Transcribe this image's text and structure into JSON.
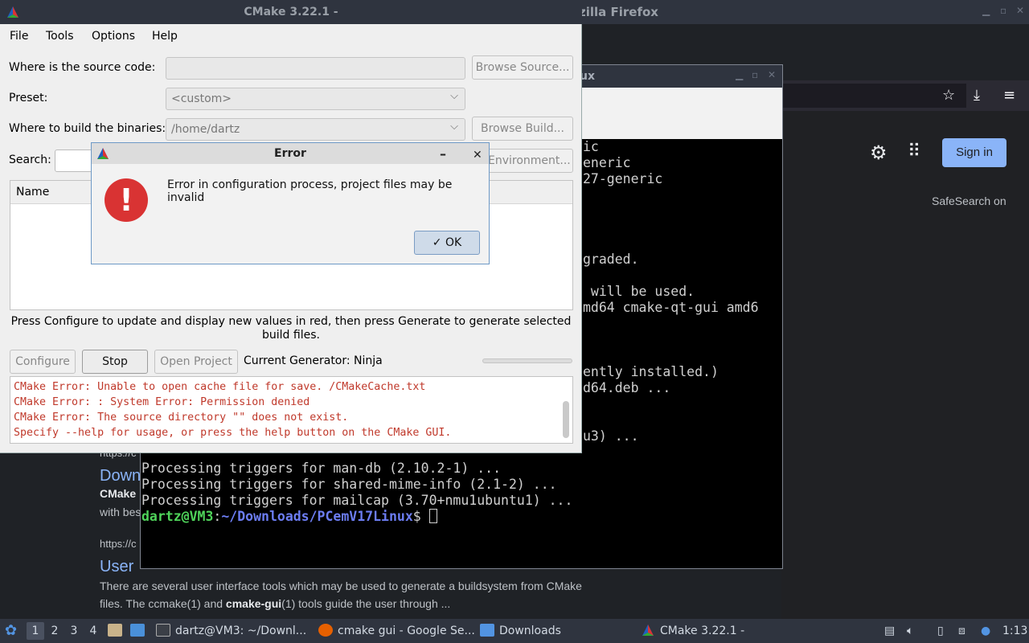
{
  "firefox": {
    "title": "zilla Firefox",
    "signin": "Sign in",
    "safesearch": "SafeSearch on",
    "results": [
      {
        "url": "https://c",
        "title": "Downl",
        "snippet_bold": "CMake",
        "snippet": "with bes"
      },
      {
        "url": "https://c",
        "title": "User",
        "snippet": "There are several user interface tools which may be used to generate a buildsystem from CMake",
        "snippet2_pre": "files. The ccmake(1) and ",
        "snippet2_bold": "cmake-gui",
        "snippet2_post": "(1) tools guide the user through ..."
      }
    ]
  },
  "terminal": {
    "title": "ux",
    "lines": [
      "ic",
      "eneric",
      "27-generic",
      "graded.",
      " will be used.",
      "md64 cmake-qt-gui amd6",
      "ently installed.)",
      "d64.deb ...",
      "u3) ...",
      "Processing triggers for man-db (2.10.2-1) ...",
      "Processing triggers for shared-mime-info (2.1-2) ...",
      "Processing triggers for mailcap (3.70+nmu1ubuntu1) ..."
    ],
    "prompt_user": "dartz@VM3",
    "prompt_sep": ":",
    "prompt_path": "~/Downloads/PCemV17Linux",
    "prompt_end": "$ "
  },
  "cmake": {
    "title": "CMake 3.22.1 -",
    "menu": {
      "file": "File",
      "tools": "Tools",
      "options": "Options",
      "help": "Help"
    },
    "source_label": "Where is the source code:",
    "source_value": "",
    "browse_source": "Browse Source...",
    "preset_label": "Preset:",
    "preset_value": "<custom>",
    "build_label": "Where to build the binaries:",
    "build_value": "/home/dartz",
    "browse_build": "Browse Build...",
    "search_label": "Search:",
    "environment": "Environment...",
    "table_header": "Name",
    "hint": "Press Configure to update and display new values in red, then press Generate to generate selected build files.",
    "configure": "Configure",
    "stop": "Stop",
    "open_project": "Open Project",
    "generator": "Current Generator: Ninja",
    "output": [
      "CMake Error: Unable to open cache file for save. /CMakeCache.txt",
      "CMake Error: : System Error: Permission denied",
      "CMake Error: The source directory \"\" does not exist.",
      "Specify --help for usage, or press the help button on the CMake GUI."
    ]
  },
  "error_dialog": {
    "title": "Error",
    "message": "Error in configuration process, project files may be invalid",
    "ok": "OK",
    "ok_icon": "✓"
  },
  "taskbar": {
    "workspaces": [
      "1",
      "2",
      "3",
      "4"
    ],
    "tasks": [
      {
        "label": "dartz@VM3: ~/Downl...",
        "icon": "terminal-icon"
      },
      {
        "label": "cmake gui - Google Se...",
        "icon": "firefox-icon"
      },
      {
        "label": "Downloads",
        "icon": "folder-icon"
      },
      {
        "label": "CMake 3.22.1 -",
        "icon": "cmake-icon"
      }
    ],
    "clock": "1:13"
  },
  "colors": {
    "accent": "#8ab4f8",
    "error_red": "#c0392b",
    "prompt_green": "#4fd35a",
    "prompt_blue": "#6c7df2"
  }
}
